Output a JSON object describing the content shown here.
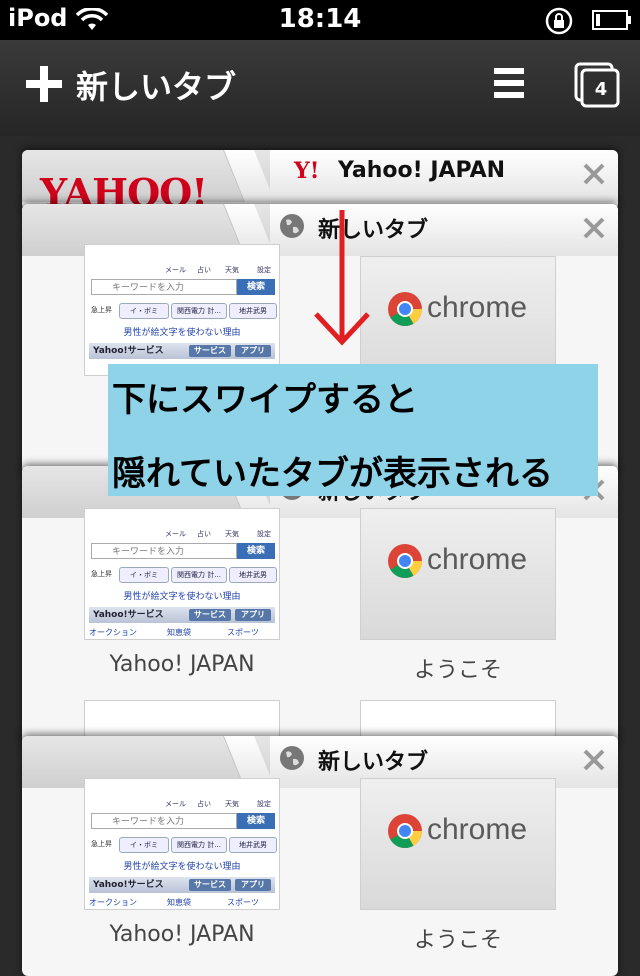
{
  "statusbar": {
    "carrier": "iPod",
    "time": "18:14"
  },
  "toolbar": {
    "new_tab_label": "新しいタブ",
    "tab_count": "4"
  },
  "cards": [
    {
      "title": "Yahoo! JAPAN",
      "logo_text": "YAHOO!",
      "mark_text": "Y!"
    },
    {
      "title": "新しいタブ"
    },
    {
      "title": "新しいタブ"
    },
    {
      "title": "新しいタブ"
    }
  ],
  "thumb": {
    "yahoo_label": "Yahoo! JAPAN",
    "chrome_label": "ようこそ",
    "chrome_word": "chrome",
    "yahoo_nav": [
      "メール",
      "占い",
      "天気",
      "設定"
    ],
    "search_placeholder": "キーワードを入力",
    "search_button": "検索",
    "trend_label": "急上昇",
    "chips": [
      "イ・ボミ",
      "関西電力 計...",
      "地井武男"
    ],
    "headline_link": "男性が絵文字を使わない理由",
    "service_label": "Yahoo!サービス",
    "service_buttons": [
      "サービス",
      "アプリ"
    ],
    "footer_links": [
      "オークション",
      "知恵袋",
      "スポーツ"
    ]
  },
  "partial_label": "Y",
  "annotation": {
    "line1": "下にスワイプすると",
    "line2": "隠れていたタブが表示される"
  },
  "colors": {
    "yahoo_red": "#d0021b",
    "annotation_bg": "#8fd3e8",
    "arrow": "#e02020"
  }
}
